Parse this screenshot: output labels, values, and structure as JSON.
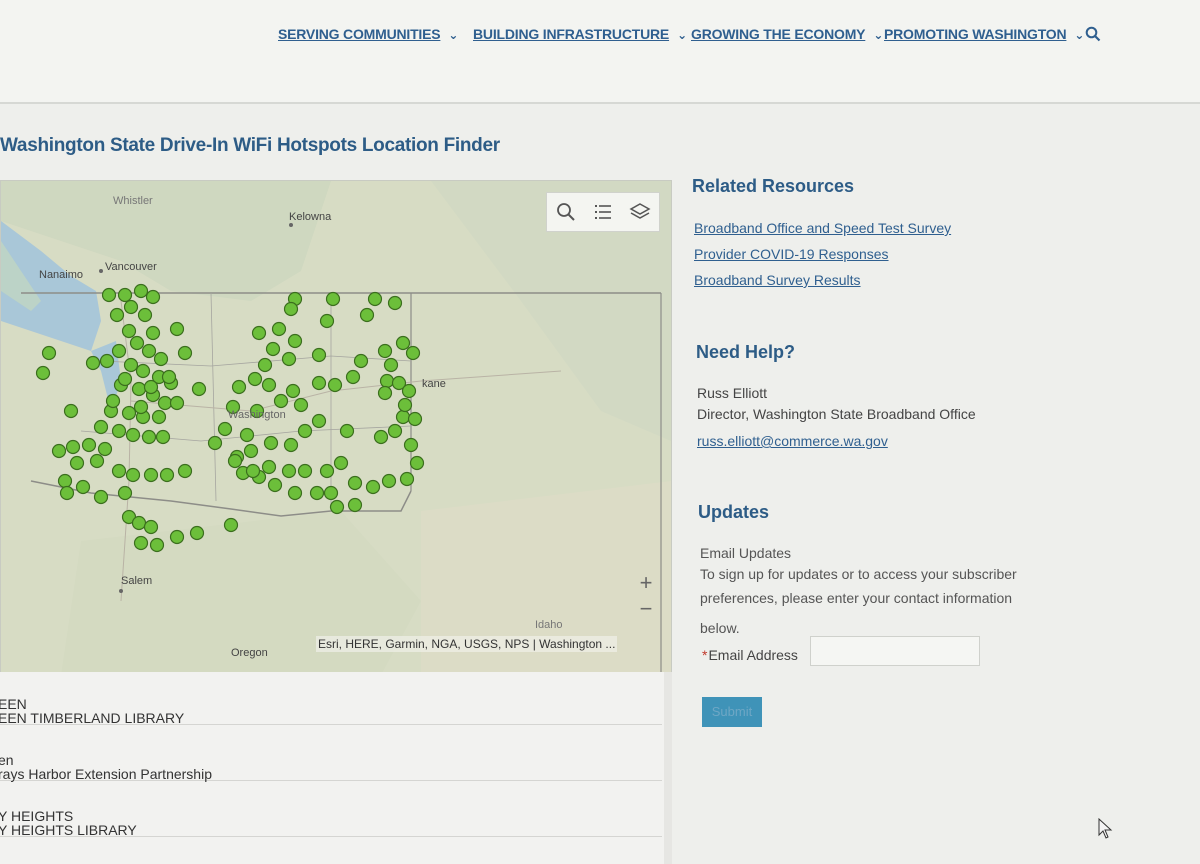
{
  "nav": {
    "items": [
      {
        "label": "SERVING COMMUNITIES",
        "chevron": "⌄"
      },
      {
        "label": "BUILDING INFRASTRUCTURE",
        "chevron": "⌄"
      },
      {
        "label": "GROWING THE ECONOMY",
        "chevron": "⌄"
      },
      {
        "label": "PROMOTING WASHINGTON",
        "chevron": "⌄"
      }
    ],
    "search_icon": "search-icon"
  },
  "page": {
    "title": "Washington State Drive-In WiFi Hotspots Location Finder"
  },
  "map": {
    "labels": {
      "whistler": "Whistler",
      "kelowna": "Kelowna",
      "nanaimo": "Nanaimo",
      "vancouver": "Vancouver",
      "spokane": "kane",
      "salem": "Salem",
      "idaho": "Idaho",
      "oregon": "Oregon",
      "washington": "Washington"
    },
    "tools": [
      "search-icon",
      "list-icon",
      "layers-icon"
    ],
    "zoom_in": "+",
    "zoom_out": "−",
    "attribution": "Esri, HERE, Garmin, NGA, USGS, NPS | Washington ...",
    "marker_color": "#6cbf3a"
  },
  "results": [
    {
      "city": "EEN",
      "site": "EEN TIMBERLAND LIBRARY"
    },
    {
      "city": "en",
      "site": "rays Harbor Extension Partnership"
    },
    {
      "city": "Y HEIGHTS",
      "site": "Y HEIGHTS LIBRARY"
    }
  ],
  "related": {
    "title": "Related Resources",
    "links": [
      "Broadband Office and Speed Test Survey",
      "Provider COVID-19 Responses",
      "Broadband Survey Results"
    ]
  },
  "help": {
    "title": "Need Help?",
    "name": "Russ Elliott",
    "role": "Director, Washington State Broadband Office",
    "email": "russ.elliott@commerce.wa.gov"
  },
  "updates": {
    "title": "Updates",
    "subtitle": "Email Updates",
    "desc_lines": [
      "To sign up for updates or to access your subscriber",
      "preferences, please enter your contact information",
      "below."
    ],
    "required_mark": "*",
    "email_label": "Email Address",
    "email_value": "",
    "submit_label": "Submit"
  },
  "colors": {
    "accent": "#2d5c86",
    "button": "#3f93b8"
  }
}
